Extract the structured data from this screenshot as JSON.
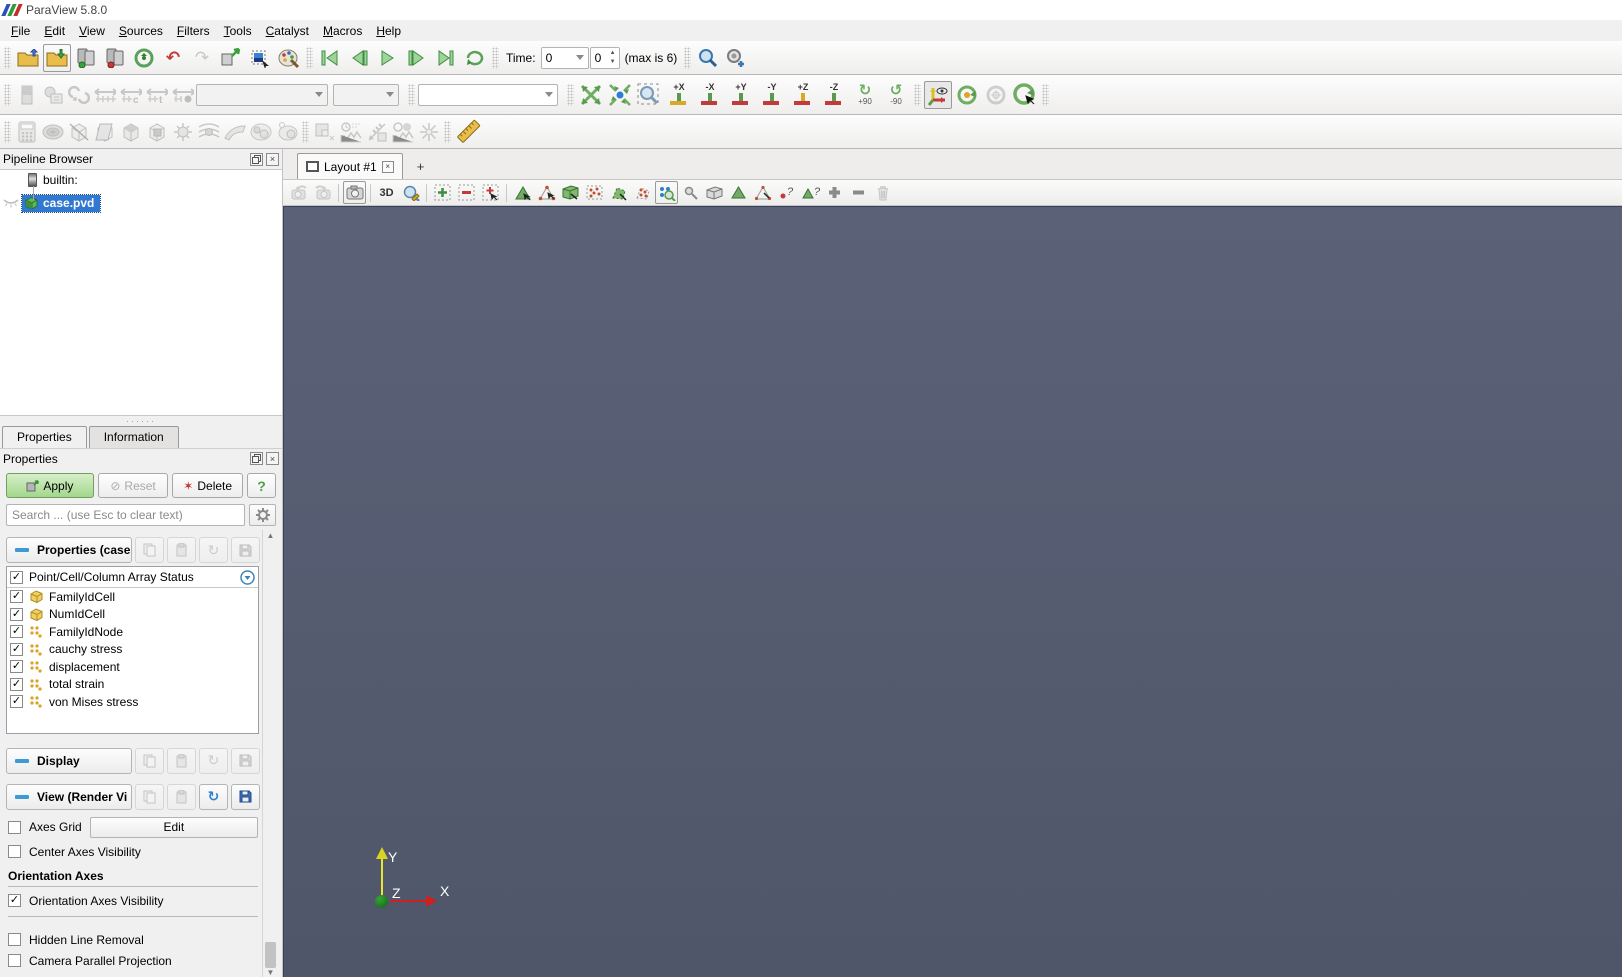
{
  "window": {
    "title": "ParaView 5.8.0"
  },
  "menus": [
    "File",
    "Edit",
    "View",
    "Sources",
    "Filters",
    "Tools",
    "Catalyst",
    "Macros",
    "Help"
  ],
  "time_controls": {
    "label": "Time:",
    "combo_value": "0",
    "spin_value": "0",
    "max_label": "(max is 6)"
  },
  "camera": {
    "direction_buttons": [
      "+X",
      "-X",
      "+Y",
      "-Y",
      "+Z",
      "-Z"
    ],
    "rotate_buttons": [
      "+90",
      "-90"
    ]
  },
  "pipeline": {
    "header": "Pipeline Browser",
    "items": [
      {
        "label": "builtin:"
      },
      {
        "label": "case.pvd",
        "selected": true
      }
    ]
  },
  "panel_tabs": {
    "properties": "Properties",
    "information": "Information"
  },
  "properties_panel": {
    "header": "Properties",
    "apply_label": "Apply",
    "reset_label": "Reset",
    "delete_label": "Delete",
    "help_label": "?",
    "search_placeholder": "Search ... (use Esc to clear text)",
    "sections": {
      "properties": "Properties (case",
      "display": "Display",
      "view": "View (Render Vi"
    },
    "array_status": {
      "header": "Point/Cell/Column Array Status",
      "items": [
        {
          "name": "FamilyIdCell",
          "type": "cell",
          "checked": true
        },
        {
          "name": "NumIdCell",
          "type": "cell",
          "checked": true
        },
        {
          "name": "FamilyIdNode",
          "type": "point",
          "checked": true
        },
        {
          "name": "cauchy stress",
          "type": "point",
          "checked": true
        },
        {
          "name": "displacement",
          "type": "point",
          "checked": true
        },
        {
          "name": "total strain",
          "type": "point",
          "checked": true
        },
        {
          "name": "von Mises stress",
          "type": "point",
          "checked": true
        }
      ]
    },
    "view_options": {
      "axes_grid_label": "Axes Grid",
      "axes_grid_checked": false,
      "edit_button": "Edit",
      "center_axes_label": "Center Axes Visibility",
      "center_axes_checked": false,
      "orientation_group_label": "Orientation Axes",
      "orientation_axes_label": "Orientation Axes Visibility",
      "orientation_axes_checked": true,
      "hidden_line_label": "Hidden Line Removal",
      "hidden_line_checked": false,
      "camera_parallel_label": "Camera Parallel Projection",
      "camera_parallel_checked": false
    },
    "check_glyph": "✓"
  },
  "layout": {
    "tab_label": "Layout #1",
    "add_tab_label": "+",
    "mode_3d_label": "3D"
  },
  "render_view": {
    "axis_labels": {
      "x": "X",
      "y": "Y",
      "z": "Z"
    },
    "axis_colors": {
      "x": "#cf1f1f",
      "y": "#e8e432",
      "z": "#1f8a1f"
    },
    "background_top": "#5b6278",
    "background_bottom": "#4f5669"
  }
}
